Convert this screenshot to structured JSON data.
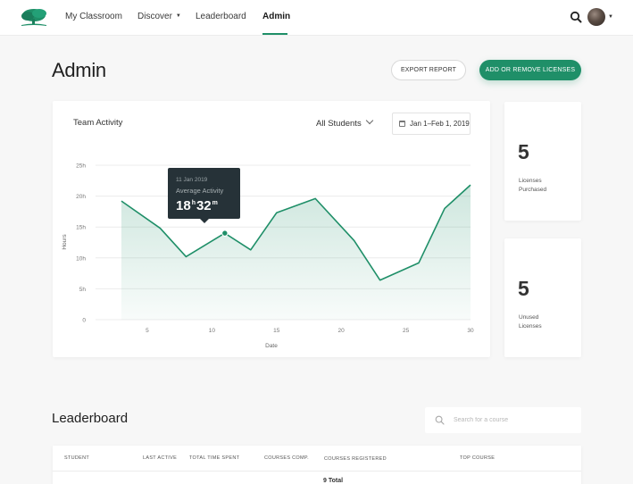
{
  "nav": {
    "items": [
      {
        "label": "My Classroom"
      },
      {
        "label": "Discover"
      },
      {
        "label": "Leaderboard"
      },
      {
        "label": "Admin"
      }
    ],
    "active": "Admin",
    "accent_color": "#1f8f68"
  },
  "header": {
    "title": "Admin",
    "export_label": "EXPORT REPORT",
    "licenses_label": "ADD OR REMOVE LICENSES"
  },
  "team_activity": {
    "title": "Team Activity",
    "filter": "All Students",
    "date_range": "Jan 1–Feb 1, 2019",
    "tooltip": {
      "date": "11 Jan 2019",
      "label": "Average Activity",
      "hours": "18",
      "h_unit": "h",
      "minutes": "32",
      "m_unit": "m"
    }
  },
  "chart_data": {
    "type": "area",
    "x": [
      3,
      6,
      8,
      11,
      13,
      15,
      18,
      21,
      23,
      26,
      28,
      30
    ],
    "y": [
      19.2,
      14.8,
      10.2,
      14,
      11.3,
      17.3,
      19.6,
      12.8,
      6.4,
      9.2,
      18,
      21.8
    ],
    "highlight_x": 11,
    "xlabel": "Date",
    "ylabel": "Hours",
    "xlim": [
      1,
      30
    ],
    "ylim": [
      0,
      25
    ],
    "x_ticks": [
      "5",
      "10",
      "15",
      "20",
      "25",
      "30"
    ],
    "y_ticks": [
      "0",
      "5h",
      "10h",
      "15h",
      "20h",
      "25h"
    ],
    "line_color": "#1f8f68",
    "grid": true
  },
  "stats": [
    {
      "value": "5",
      "label_1": "Licenses",
      "label_2": "Purchased"
    },
    {
      "value": "5",
      "label_1": "Unused",
      "label_2": "Licenses"
    }
  ],
  "leaderboard": {
    "title": "Leaderboard",
    "search_placeholder": "Search for a course",
    "columns": [
      "STUDENT",
      "LAST ACTIVE",
      "TOTAL TIME SPENT",
      "COURSES COMP.",
      "COURSES REGISTERED",
      "TOP COURSE"
    ],
    "total_label": "9 Total"
  }
}
